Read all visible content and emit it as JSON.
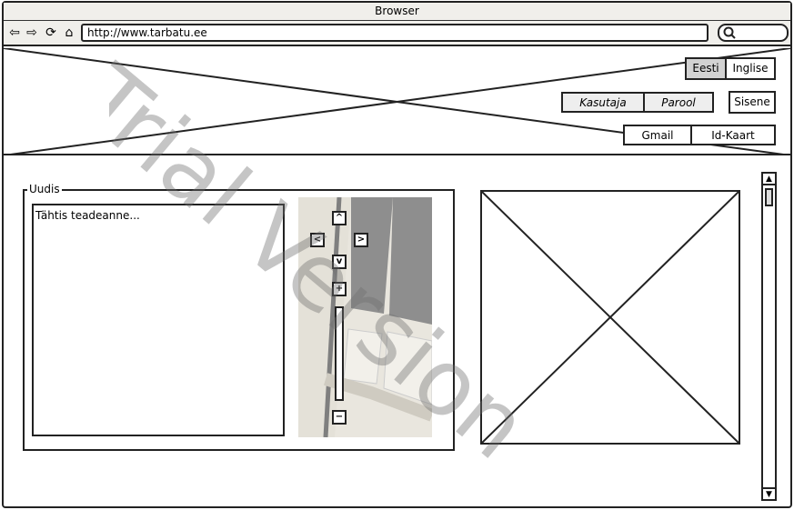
{
  "browser": {
    "title": "Browser",
    "url": "http://www.tarbatu.ee"
  },
  "header": {
    "languages": [
      "Eesti",
      "Inglise"
    ],
    "username_placeholder": "Kasutaja",
    "password_placeholder": "Parool",
    "login_label": "Sisene",
    "alt_logins": [
      "Gmail",
      "Id-Kaart"
    ]
  },
  "news": {
    "legend": "Uudis",
    "text": "Tähtis teadeanne..."
  },
  "map": {
    "pan_up": "^",
    "pan_left": "<",
    "pan_right": ">",
    "pan_down": "v",
    "zoom_in": "+",
    "zoom_out": "−"
  },
  "watermark": "Trial Version"
}
